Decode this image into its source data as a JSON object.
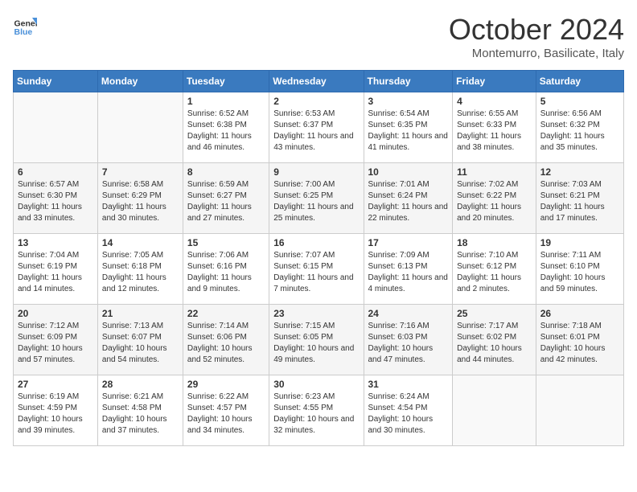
{
  "header": {
    "logo_general": "General",
    "logo_blue": "Blue",
    "month_title": "October 2024",
    "location": "Montemurro, Basilicate, Italy"
  },
  "days_of_week": [
    "Sunday",
    "Monday",
    "Tuesday",
    "Wednesday",
    "Thursday",
    "Friday",
    "Saturday"
  ],
  "weeks": [
    [
      {
        "day": "",
        "sunrise": "",
        "sunset": "",
        "daylight": ""
      },
      {
        "day": "",
        "sunrise": "",
        "sunset": "",
        "daylight": ""
      },
      {
        "day": "1",
        "sunrise": "Sunrise: 6:52 AM",
        "sunset": "Sunset: 6:38 PM",
        "daylight": "Daylight: 11 hours and 46 minutes."
      },
      {
        "day": "2",
        "sunrise": "Sunrise: 6:53 AM",
        "sunset": "Sunset: 6:37 PM",
        "daylight": "Daylight: 11 hours and 43 minutes."
      },
      {
        "day": "3",
        "sunrise": "Sunrise: 6:54 AM",
        "sunset": "Sunset: 6:35 PM",
        "daylight": "Daylight: 11 hours and 41 minutes."
      },
      {
        "day": "4",
        "sunrise": "Sunrise: 6:55 AM",
        "sunset": "Sunset: 6:33 PM",
        "daylight": "Daylight: 11 hours and 38 minutes."
      },
      {
        "day": "5",
        "sunrise": "Sunrise: 6:56 AM",
        "sunset": "Sunset: 6:32 PM",
        "daylight": "Daylight: 11 hours and 35 minutes."
      }
    ],
    [
      {
        "day": "6",
        "sunrise": "Sunrise: 6:57 AM",
        "sunset": "Sunset: 6:30 PM",
        "daylight": "Daylight: 11 hours and 33 minutes."
      },
      {
        "day": "7",
        "sunrise": "Sunrise: 6:58 AM",
        "sunset": "Sunset: 6:29 PM",
        "daylight": "Daylight: 11 hours and 30 minutes."
      },
      {
        "day": "8",
        "sunrise": "Sunrise: 6:59 AM",
        "sunset": "Sunset: 6:27 PM",
        "daylight": "Daylight: 11 hours and 27 minutes."
      },
      {
        "day": "9",
        "sunrise": "Sunrise: 7:00 AM",
        "sunset": "Sunset: 6:25 PM",
        "daylight": "Daylight: 11 hours and 25 minutes."
      },
      {
        "day": "10",
        "sunrise": "Sunrise: 7:01 AM",
        "sunset": "Sunset: 6:24 PM",
        "daylight": "Daylight: 11 hours and 22 minutes."
      },
      {
        "day": "11",
        "sunrise": "Sunrise: 7:02 AM",
        "sunset": "Sunset: 6:22 PM",
        "daylight": "Daylight: 11 hours and 20 minutes."
      },
      {
        "day": "12",
        "sunrise": "Sunrise: 7:03 AM",
        "sunset": "Sunset: 6:21 PM",
        "daylight": "Daylight: 11 hours and 17 minutes."
      }
    ],
    [
      {
        "day": "13",
        "sunrise": "Sunrise: 7:04 AM",
        "sunset": "Sunset: 6:19 PM",
        "daylight": "Daylight: 11 hours and 14 minutes."
      },
      {
        "day": "14",
        "sunrise": "Sunrise: 7:05 AM",
        "sunset": "Sunset: 6:18 PM",
        "daylight": "Daylight: 11 hours and 12 minutes."
      },
      {
        "day": "15",
        "sunrise": "Sunrise: 7:06 AM",
        "sunset": "Sunset: 6:16 PM",
        "daylight": "Daylight: 11 hours and 9 minutes."
      },
      {
        "day": "16",
        "sunrise": "Sunrise: 7:07 AM",
        "sunset": "Sunset: 6:15 PM",
        "daylight": "Daylight: 11 hours and 7 minutes."
      },
      {
        "day": "17",
        "sunrise": "Sunrise: 7:09 AM",
        "sunset": "Sunset: 6:13 PM",
        "daylight": "Daylight: 11 hours and 4 minutes."
      },
      {
        "day": "18",
        "sunrise": "Sunrise: 7:10 AM",
        "sunset": "Sunset: 6:12 PM",
        "daylight": "Daylight: 11 hours and 2 minutes."
      },
      {
        "day": "19",
        "sunrise": "Sunrise: 7:11 AM",
        "sunset": "Sunset: 6:10 PM",
        "daylight": "Daylight: 10 hours and 59 minutes."
      }
    ],
    [
      {
        "day": "20",
        "sunrise": "Sunrise: 7:12 AM",
        "sunset": "Sunset: 6:09 PM",
        "daylight": "Daylight: 10 hours and 57 minutes."
      },
      {
        "day": "21",
        "sunrise": "Sunrise: 7:13 AM",
        "sunset": "Sunset: 6:07 PM",
        "daylight": "Daylight: 10 hours and 54 minutes."
      },
      {
        "day": "22",
        "sunrise": "Sunrise: 7:14 AM",
        "sunset": "Sunset: 6:06 PM",
        "daylight": "Daylight: 10 hours and 52 minutes."
      },
      {
        "day": "23",
        "sunrise": "Sunrise: 7:15 AM",
        "sunset": "Sunset: 6:05 PM",
        "daylight": "Daylight: 10 hours and 49 minutes."
      },
      {
        "day": "24",
        "sunrise": "Sunrise: 7:16 AM",
        "sunset": "Sunset: 6:03 PM",
        "daylight": "Daylight: 10 hours and 47 minutes."
      },
      {
        "day": "25",
        "sunrise": "Sunrise: 7:17 AM",
        "sunset": "Sunset: 6:02 PM",
        "daylight": "Daylight: 10 hours and 44 minutes."
      },
      {
        "day": "26",
        "sunrise": "Sunrise: 7:18 AM",
        "sunset": "Sunset: 6:01 PM",
        "daylight": "Daylight: 10 hours and 42 minutes."
      }
    ],
    [
      {
        "day": "27",
        "sunrise": "Sunrise: 6:19 AM",
        "sunset": "Sunset: 4:59 PM",
        "daylight": "Daylight: 10 hours and 39 minutes."
      },
      {
        "day": "28",
        "sunrise": "Sunrise: 6:21 AM",
        "sunset": "Sunset: 4:58 PM",
        "daylight": "Daylight: 10 hours and 37 minutes."
      },
      {
        "day": "29",
        "sunrise": "Sunrise: 6:22 AM",
        "sunset": "Sunset: 4:57 PM",
        "daylight": "Daylight: 10 hours and 34 minutes."
      },
      {
        "day": "30",
        "sunrise": "Sunrise: 6:23 AM",
        "sunset": "Sunset: 4:55 PM",
        "daylight": "Daylight: 10 hours and 32 minutes."
      },
      {
        "day": "31",
        "sunrise": "Sunrise: 6:24 AM",
        "sunset": "Sunset: 4:54 PM",
        "daylight": "Daylight: 10 hours and 30 minutes."
      },
      {
        "day": "",
        "sunrise": "",
        "sunset": "",
        "daylight": ""
      },
      {
        "day": "",
        "sunrise": "",
        "sunset": "",
        "daylight": ""
      }
    ]
  ]
}
